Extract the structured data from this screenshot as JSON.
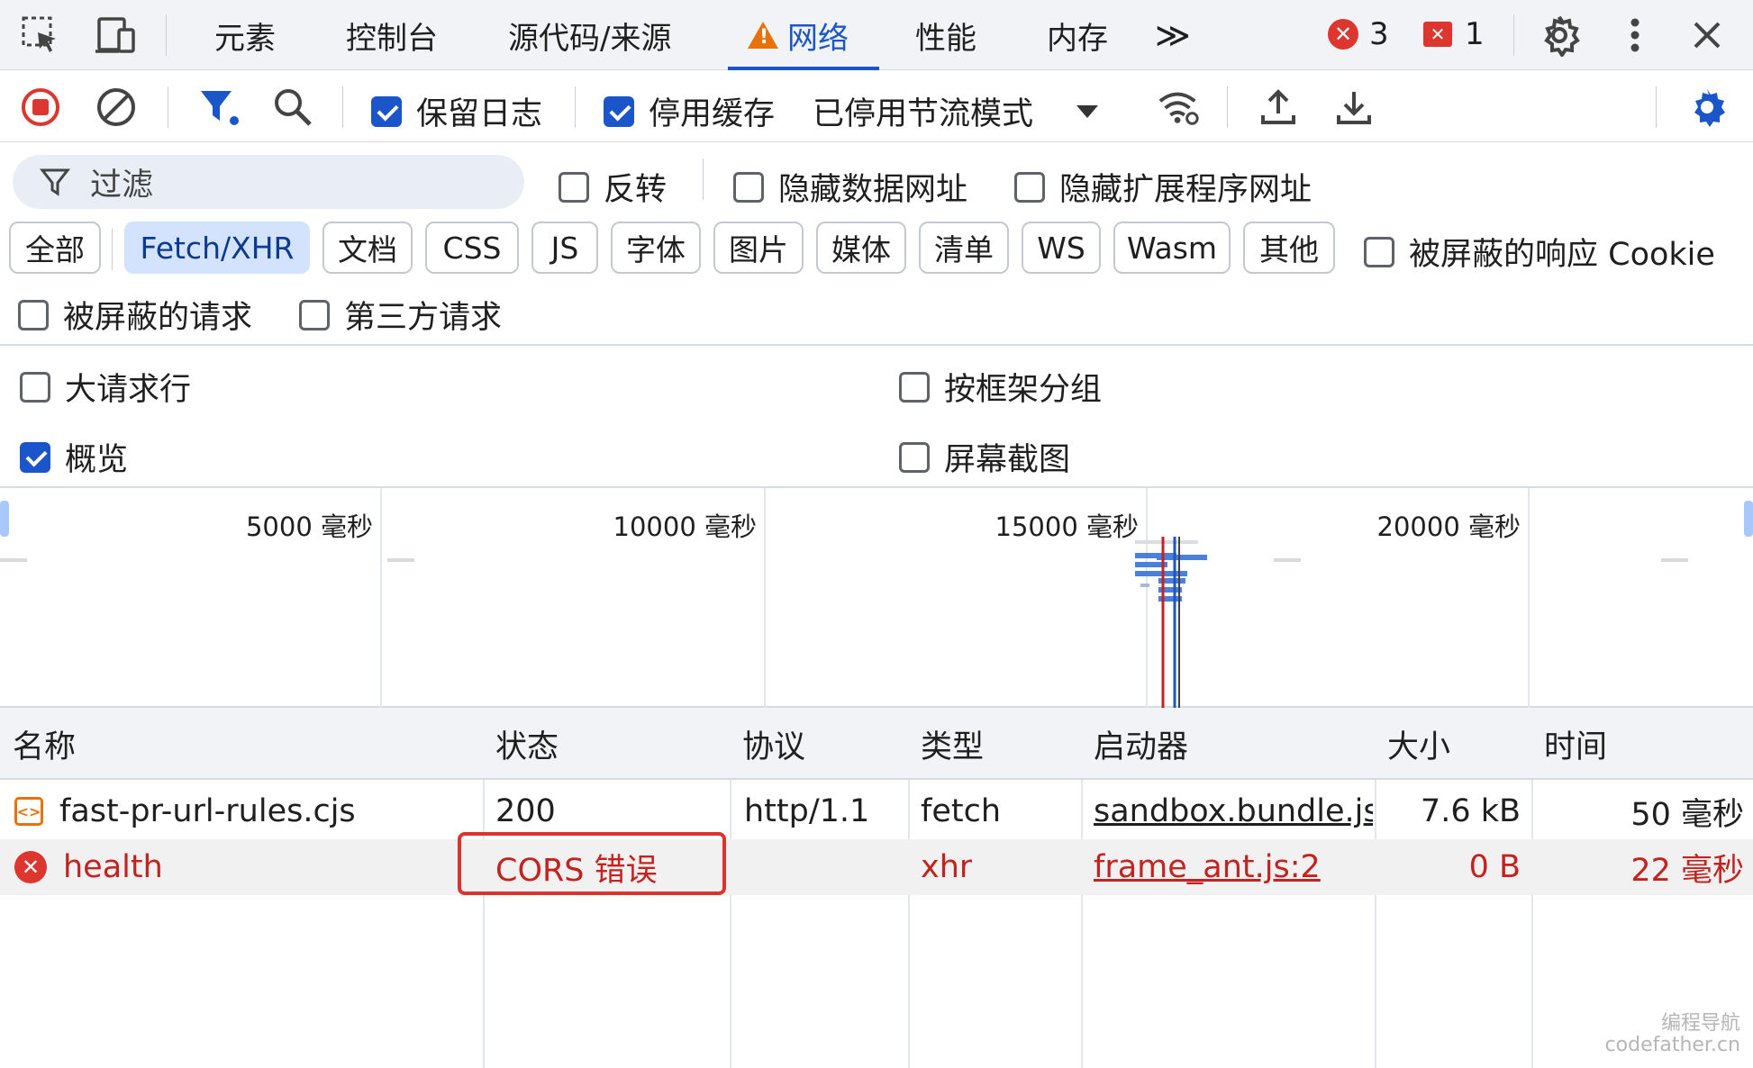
{
  "tabbar": {
    "tabs": [
      {
        "label": "元素"
      },
      {
        "label": "控制台"
      },
      {
        "label": "源代码/来源"
      },
      {
        "label": "网络"
      },
      {
        "label": "性能"
      },
      {
        "label": "内存"
      }
    ],
    "more_label": "≫",
    "errors_count": "3",
    "issues_count": "1"
  },
  "toolbar": {
    "preserve_log": {
      "label": "保留日志",
      "checked": true
    },
    "disable_cache": {
      "label": "停用缓存",
      "checked": true
    },
    "throttling_label": "已停用节流模式"
  },
  "filter": {
    "placeholder": "过滤",
    "invert_label": "反转",
    "hide_data_urls_label": "隐藏数据网址",
    "hide_extension_urls_label": "隐藏扩展程序网址",
    "types": [
      "全部",
      "Fetch/XHR",
      "文档",
      "CSS",
      "JS",
      "字体",
      "图片",
      "媒体",
      "清单",
      "WS",
      "Wasm",
      "其他"
    ],
    "active_type": "Fetch/XHR",
    "blocked_cookies_label": "被屏蔽的响应 Cookie",
    "blocked_requests_label": "被屏蔽的请求",
    "third_party_label": "第三方请求"
  },
  "settings": {
    "big_rows_label": "大请求行",
    "group_by_frame_label": "按框架分组",
    "overview_label": "概览",
    "screenshots_label": "屏幕截图"
  },
  "overview": {
    "labels": [
      "5000 毫秒",
      "10000 毫秒",
      "15000 毫秒",
      "20000 毫秒"
    ]
  },
  "table": {
    "headers": [
      "名称",
      "状态",
      "协议",
      "类型",
      "启动器",
      "大小",
      "时间"
    ],
    "rows": [
      {
        "name": "fast-pr-url-rules.cjs",
        "status": "200",
        "protocol": "http/1.1",
        "type": "fetch",
        "initiator": "sandbox.bundle.js",
        "size": "7.6 kB",
        "time": "50 毫秒",
        "error": false
      },
      {
        "name": "health",
        "status": "CORS 错误",
        "protocol": "",
        "type": "xhr",
        "initiator": "frame_ant.js:2",
        "size": "0 B",
        "time": "22 毫秒",
        "error": true
      }
    ]
  },
  "watermark": {
    "line1": "编程导航",
    "line2": "codefather.cn"
  },
  "colors": {
    "accent": "#1a56c9",
    "error": "#dc362e",
    "warning": "#e8710a"
  }
}
